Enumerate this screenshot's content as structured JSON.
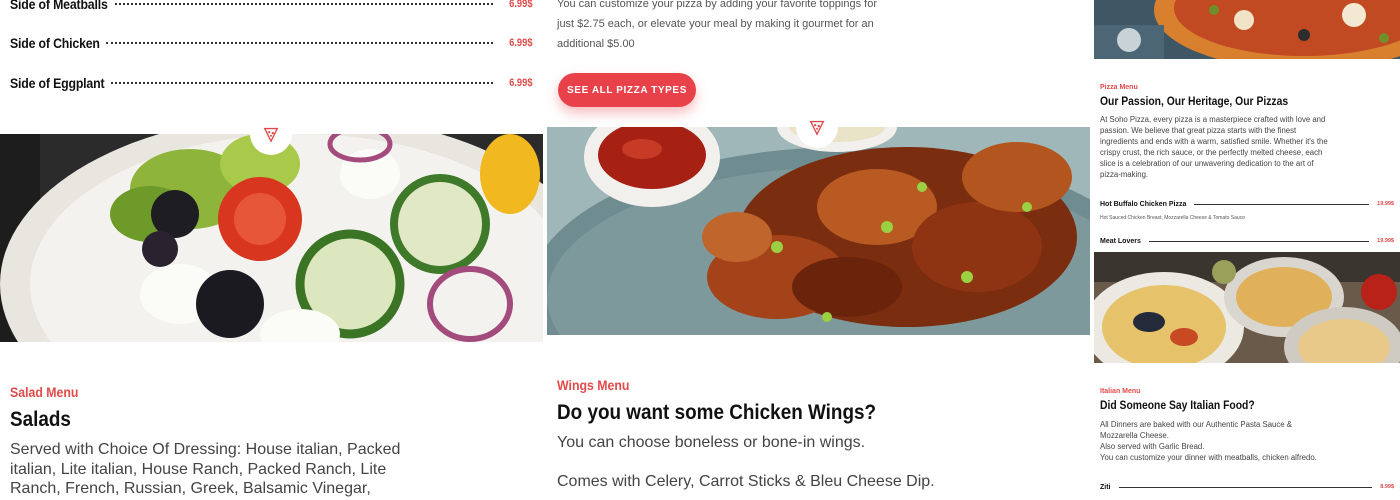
{
  "left_menu": {
    "items": [
      {
        "name": "Side of Meatballs",
        "price": "6.99$"
      },
      {
        "name": "Side of Chicken",
        "price": "6.99$"
      },
      {
        "name": "Side of Eggplant",
        "price": "6.99$"
      }
    ]
  },
  "pizza_toppings": {
    "text": "You can customize your pizza by adding your favorite toppings for just $2.75 each, or elevate your meal by making it gourmet for an additional $5.00",
    "button_label": "SEE ALL PIZZA TYPES"
  },
  "salad_section": {
    "eyebrow": "Salad Menu",
    "title": "Salads",
    "description": "Served with Choice Of Dressing: House italian, Packed italian, Lite italian, House Ranch, Packed Ranch, Lite Ranch, French, Russian, Greek, Balsamic Vinegar, Thousand Island or Caesar"
  },
  "wings_section": {
    "eyebrow": "Wings Menu",
    "title": "Do you want some Chicken Wings?",
    "line1": "You can choose boneless or bone-in wings.",
    "line2": "Comes with Celery, Carrot Sticks & Bleu Cheese Dip."
  },
  "pizza_section": {
    "eyebrow": "Pizza Menu",
    "title": "Our Passion, Our Heritage, Our Pizzas",
    "description": "At Soho Pizza, every pizza is a masterpiece crafted with love and passion. We believe that great pizza starts with the finest ingredients and ends with a warm, satisfied smile. Whether it's the crispy crust, the rich sauce, or the perfectly melted cheese, each slice is a celebration of our unwavering dedication to the art of pizza-making.",
    "items": [
      {
        "name": "Hot Buffalo Chicken Pizza",
        "price": "19.99$",
        "sub": "Hot Sauced Chicken Breast, Mozzarella Cheese & Tomato Sauce"
      },
      {
        "name": "Meat Lovers",
        "price": "19.99$"
      }
    ]
  },
  "italian_section": {
    "eyebrow": "Italian Menu",
    "title": "Did Someone Say Italian Food?",
    "line1": "All Dinners are baked with our Authentic Pasta Sauce & Mozzarella Cheese.",
    "line2": "Also served with Garlic Bread.",
    "line3": "You can customize your dinner with meatballs, chicken alfredo.",
    "items": [
      {
        "name": "Ziti",
        "price": "8.99$"
      }
    ]
  },
  "colors": {
    "accent": "#e14a4a",
    "button": "#e8414a"
  },
  "icons": {
    "section_pin": "pizza-slice-icon"
  }
}
